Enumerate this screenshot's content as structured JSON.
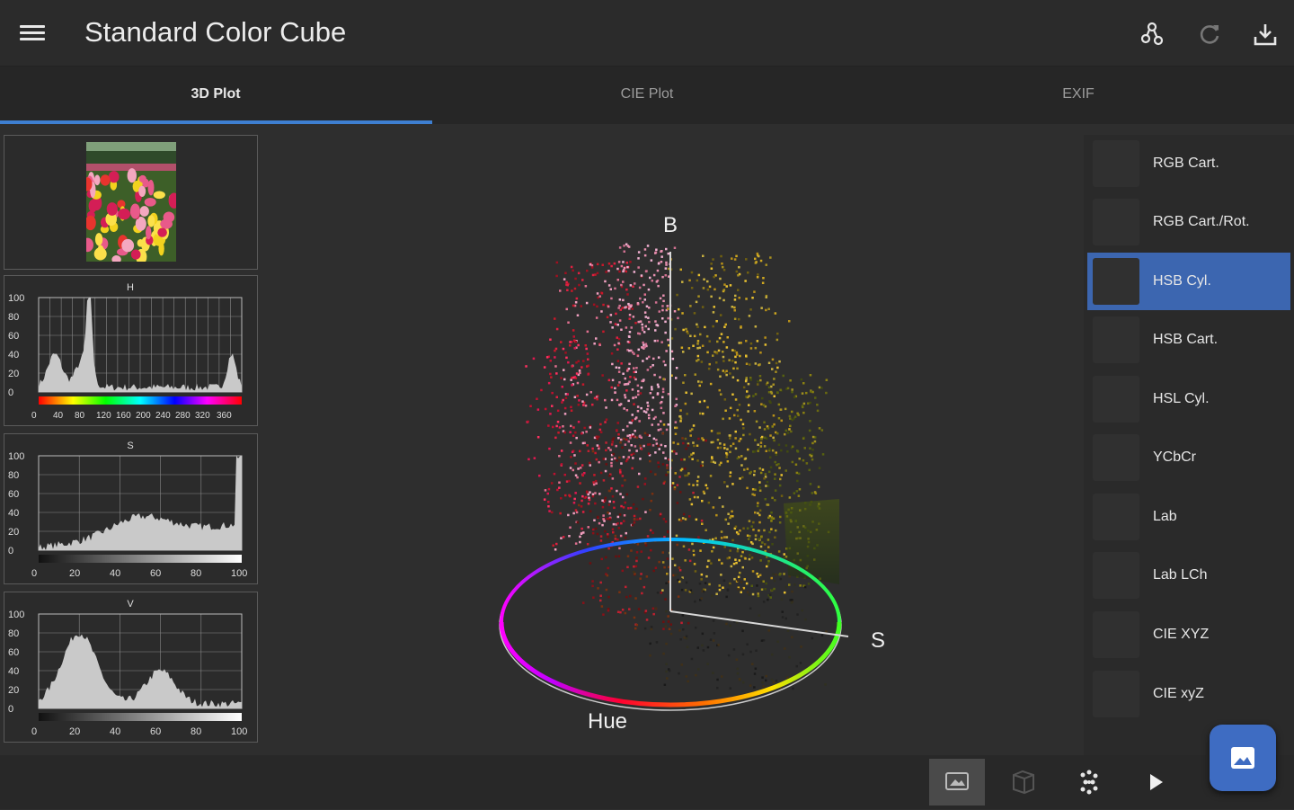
{
  "app": {
    "title": "Standard Color Cube"
  },
  "toolbar": {
    "icons": [
      "hamburger-menu-icon",
      "share-nodes-icon",
      "refresh-icon",
      "download-icon"
    ]
  },
  "tabs": [
    {
      "label": "3D Plot",
      "active": true
    },
    {
      "label": "CIE Plot",
      "active": false
    },
    {
      "label": "EXIF",
      "active": false
    }
  ],
  "histograms": [
    {
      "title": "H",
      "y_ticks": [
        "100",
        "80",
        "60",
        "40",
        "20",
        "0"
      ],
      "x_ticks": [
        "0",
        "40",
        "80",
        "120",
        "160",
        "200",
        "240",
        "280",
        "320",
        "360"
      ]
    },
    {
      "title": "S",
      "y_ticks": [
        "100",
        "80",
        "60",
        "40",
        "20",
        "0"
      ],
      "x_ticks": [
        "0",
        "20",
        "40",
        "60",
        "80",
        "100"
      ]
    },
    {
      "title": "V",
      "y_ticks": [
        "100",
        "80",
        "60",
        "40",
        "20",
        "0"
      ],
      "x_ticks": [
        "0",
        "20",
        "40",
        "60",
        "80",
        "100"
      ]
    }
  ],
  "plot": {
    "axis_b": "B",
    "axis_s": "S",
    "axis_hue": "Hue"
  },
  "modes": [
    {
      "label": "RGB Cart.",
      "selected": false
    },
    {
      "label": "RGB Cart./Rot.",
      "selected": false
    },
    {
      "label": "HSB Cyl.",
      "selected": true
    },
    {
      "label": "HSB Cart.",
      "selected": false
    },
    {
      "label": "HSL Cyl.",
      "selected": false
    },
    {
      "label": "YCbCr",
      "selected": false
    },
    {
      "label": "Lab",
      "selected": false
    },
    {
      "label": "Lab LCh",
      "selected": false
    },
    {
      "label": "CIE XYZ",
      "selected": false
    },
    {
      "label": "CIE xyZ",
      "selected": false
    }
  ],
  "bottom_icons": [
    "image-view-icon",
    "cube-icon",
    "scatter-points-icon",
    "play-icon"
  ],
  "fab_icon": "image-icon",
  "colors": {
    "accent": "#3e7fd1",
    "selected": "#3c66b0",
    "background": "#2e2e2e"
  }
}
